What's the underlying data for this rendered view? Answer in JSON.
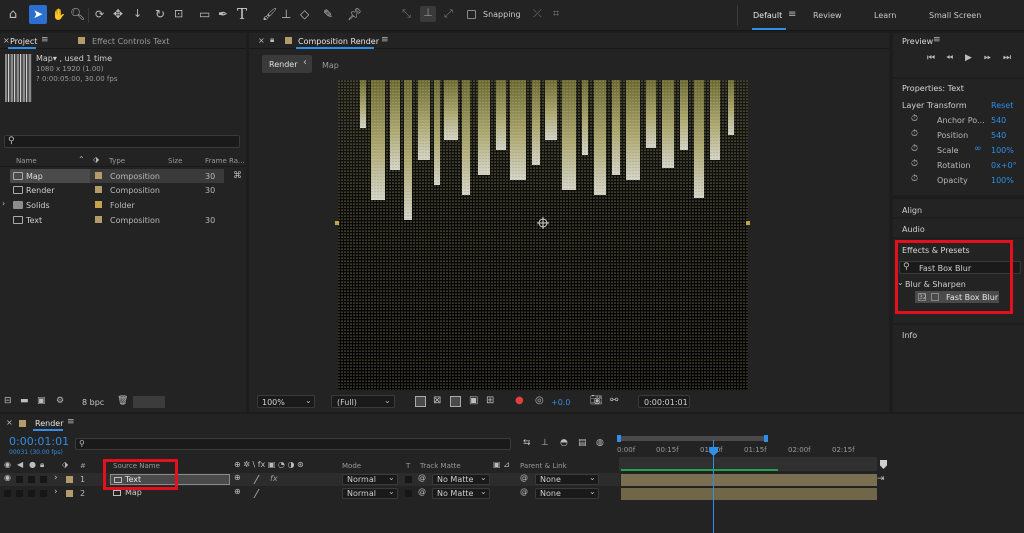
{
  "toolbar": {
    "snapping_label": "Snapping",
    "workspaces": [
      "Default",
      "Review",
      "Learn",
      "Small Screen"
    ]
  },
  "project": {
    "tab_project": "Project",
    "tab_effect_controls": "Effect Controls Text",
    "preview_name": "Map▾ , used 1 time",
    "preview_res": "1080 x 1920 (1.00)",
    "preview_dur": "? 0:00:05:00, 30.00 fps",
    "columns": [
      "Name",
      "Type",
      "Size",
      "Frame Ra..."
    ],
    "items": [
      {
        "name": "Map",
        "type": "Composition",
        "fps": "30",
        "color": "#b39b6b",
        "selected": true
      },
      {
        "name": "Render",
        "type": "Composition",
        "fps": "30",
        "color": "#b39b6b",
        "selected": false
      },
      {
        "name": "Solids",
        "type": "Folder",
        "fps": "",
        "color": "#c6a24e",
        "selected": false
      },
      {
        "name": "Text",
        "type": "Composition",
        "fps": "30",
        "color": "#b39b6b",
        "selected": false
      }
    ],
    "bpc": "8 bpc"
  },
  "composition": {
    "tab_title": "Composition Render",
    "breadcrumb_render": "Render",
    "breadcrumb_map": "Map",
    "zoom": "100%",
    "resolution": "(Full)",
    "exposure": "+0.0",
    "timecode": "0:00:01:01"
  },
  "right": {
    "preview_title": "Preview",
    "properties_title": "Properties: Text",
    "layer_transform": "Layer Transform",
    "reset": "Reset",
    "props": [
      {
        "name": "Anchor Po...",
        "value": "540"
      },
      {
        "name": "Position",
        "value": "540"
      },
      {
        "name": "Scale",
        "value": "100%"
      },
      {
        "name": "Rotation",
        "value": "0x+0°"
      },
      {
        "name": "Opacity",
        "value": "100%"
      }
    ],
    "align": "Align",
    "audio": "Audio",
    "effects_title": "Effects & Presets",
    "effects_search": "Fast Box Blur",
    "effects_category": "Blur & Sharpen",
    "effects_item": "Fast Box Blur",
    "info": "Info"
  },
  "timeline": {
    "tab_title": "Render",
    "timecode": "0:00:01:01",
    "frames": "00031 (30.00 fps)",
    "col_source": "Source Name",
    "col_mode": "Mode",
    "col_t": "T",
    "col_trackmatte": "Track Matte",
    "col_parent": "Parent & Link",
    "ruler": [
      "0:00f",
      "00:15f",
      "01:00f",
      "01:15f",
      "02:00f",
      "02:15f"
    ],
    "layers": [
      {
        "num": "1",
        "name": "Text",
        "mode": "Normal",
        "matte": "No Matte",
        "parent": "None"
      },
      {
        "num": "2",
        "name": "Map",
        "mode": "Normal",
        "matte": "No Matte",
        "parent": "None"
      }
    ]
  }
}
